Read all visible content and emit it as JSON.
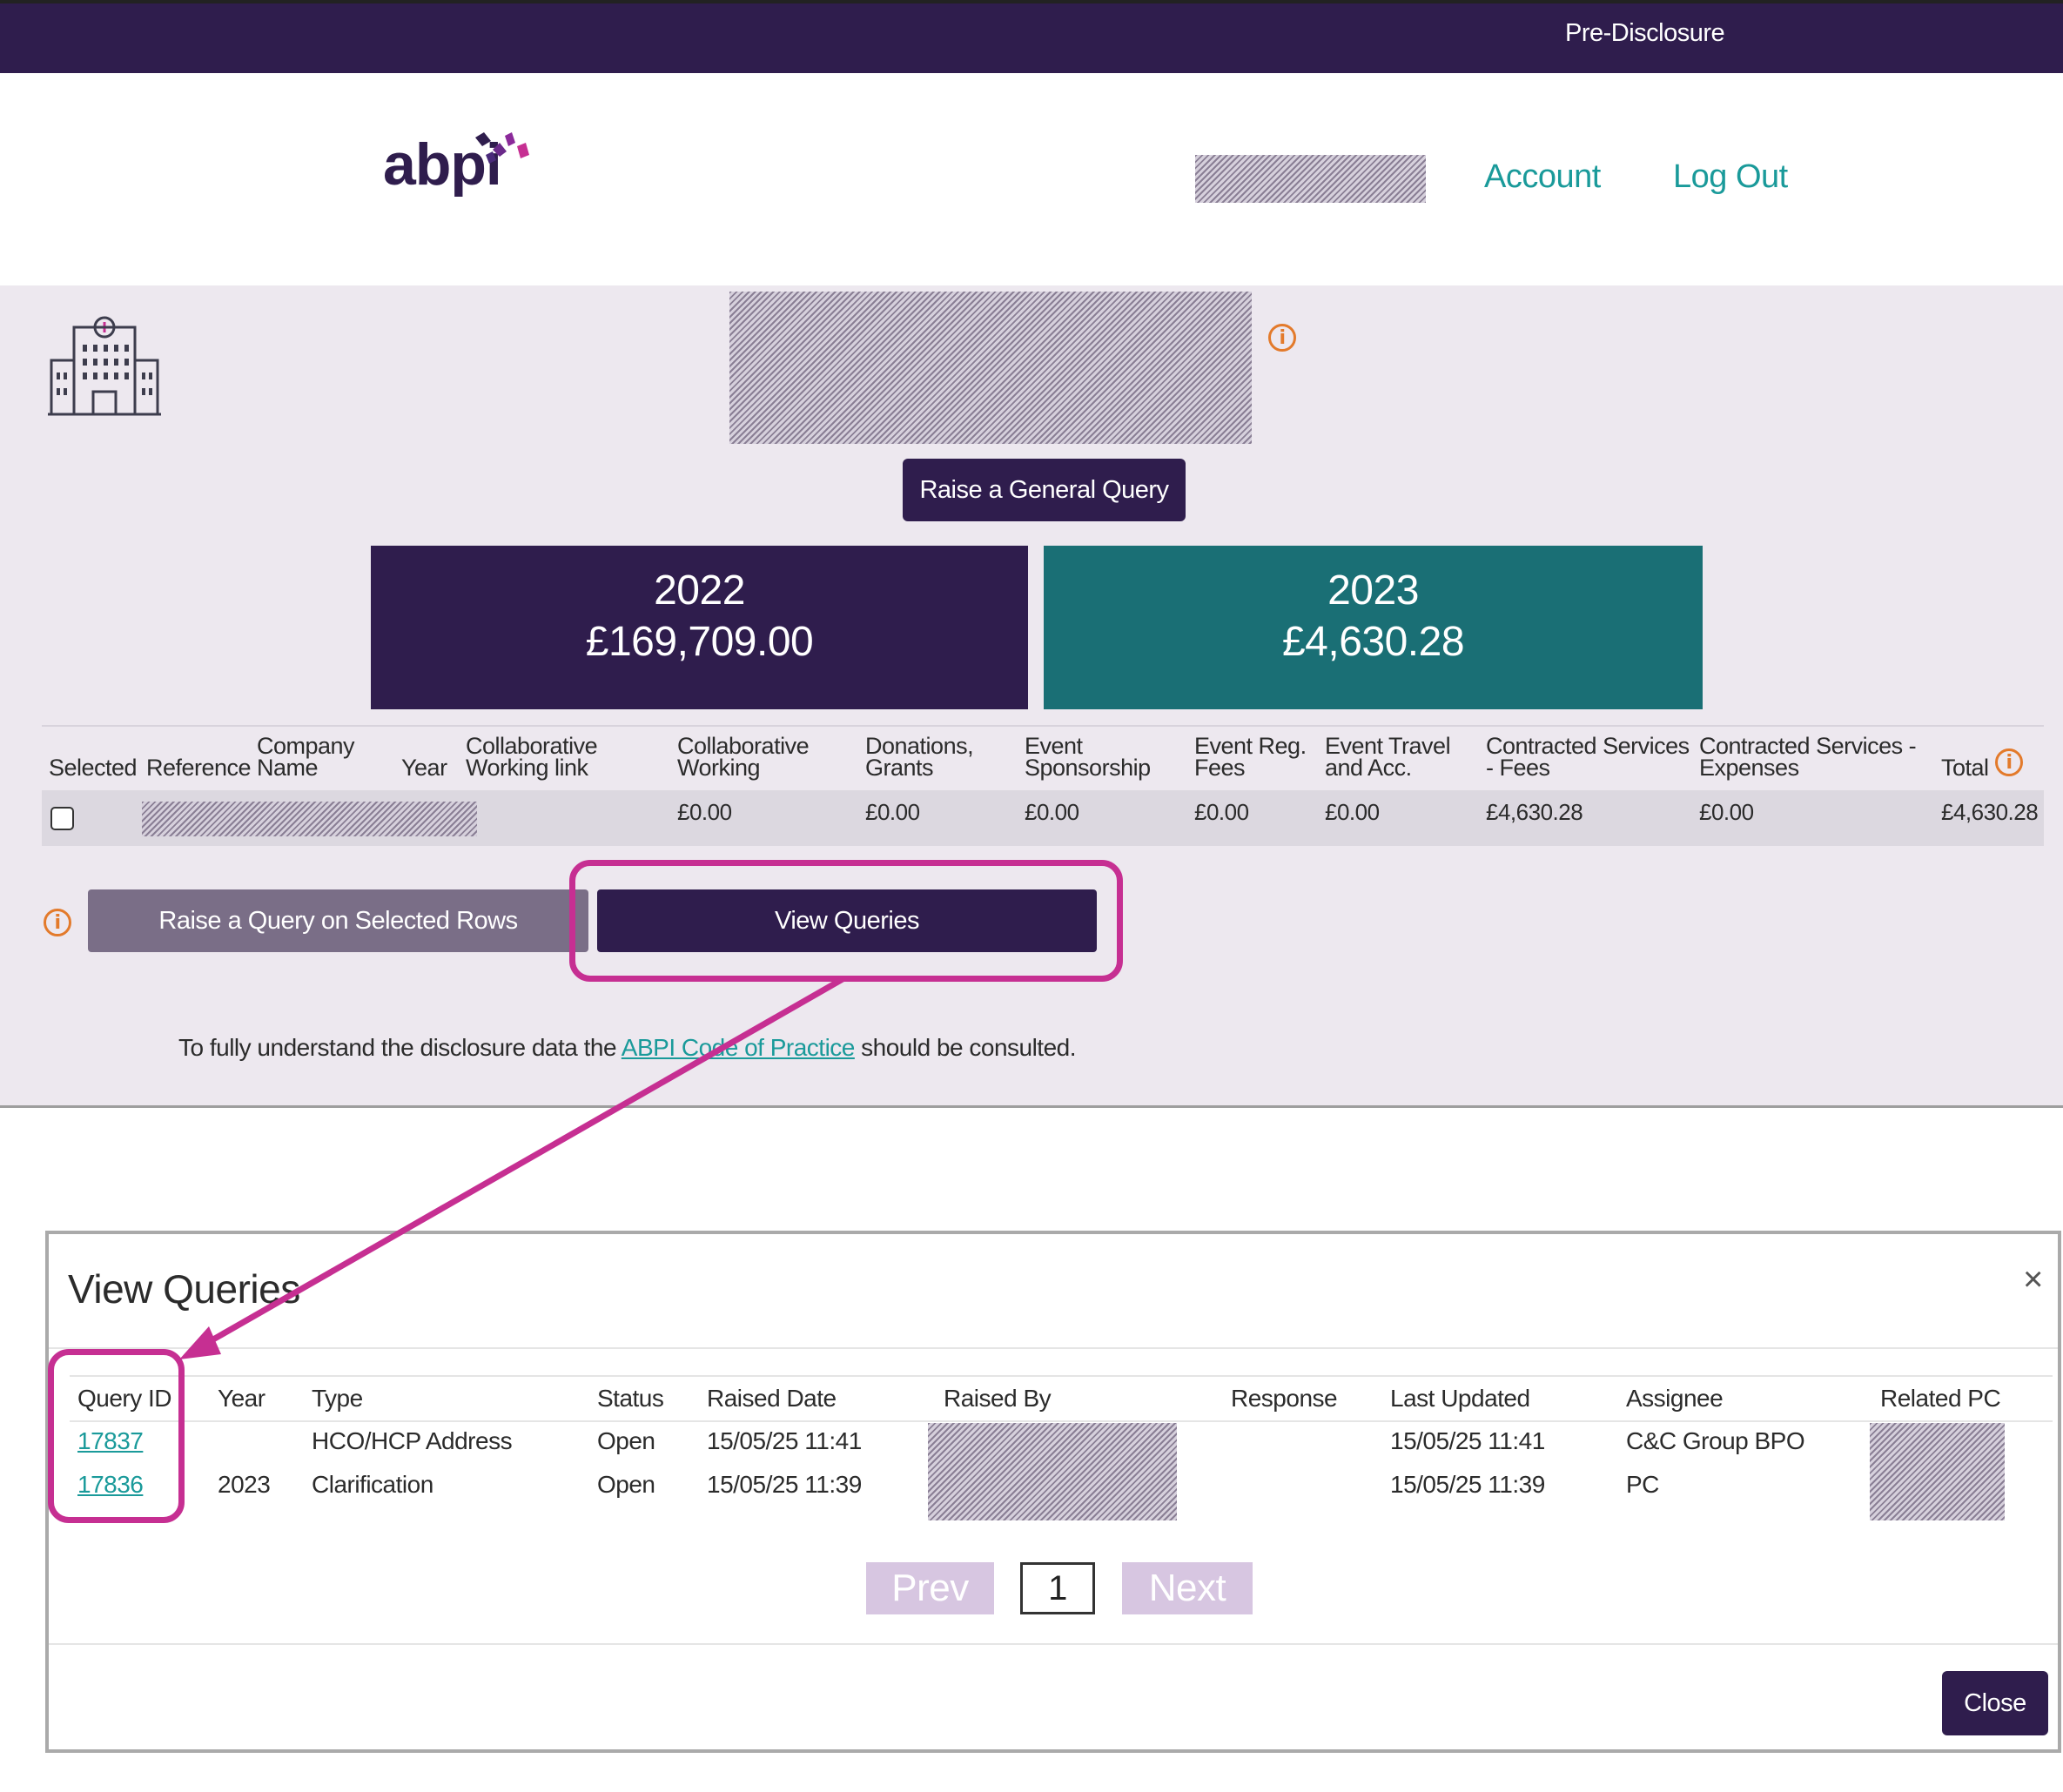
{
  "topbar": {
    "pre_disclosure": "Pre-Disclosure"
  },
  "header": {
    "logo_text": "abpi",
    "nav": {
      "account": "Account",
      "logout": "Log Out"
    }
  },
  "profile": {
    "raise_general_query": "Raise a General Query",
    "totals": [
      {
        "year": "2022",
        "amount": "£169,709.00"
      },
      {
        "year": "2023",
        "amount": "£4,630.28"
      }
    ]
  },
  "table": {
    "headers": {
      "selected": "Selected",
      "reference": "Reference",
      "company_name_1": "Company",
      "company_name_2": "Name",
      "year": "Year",
      "collab_link_1": "Collaborative",
      "collab_link_2": "Working link",
      "collab_1": "Collaborative",
      "collab_2": "Working",
      "donations_1": "Donations,",
      "donations_2": "Grants",
      "event_sp_1": "Event",
      "event_sp_2": "Sponsorship",
      "event_reg_1": "Event Reg.",
      "event_reg_2": "Fees",
      "event_travel_1": "Event Travel",
      "event_travel_2": "and Acc.",
      "cs_fees_1": "Contracted Services",
      "cs_fees_2": "- Fees",
      "cs_exp_1": "Contracted Services -",
      "cs_exp_2": "Expenses",
      "total": "Total"
    },
    "row": {
      "collab": "£0.00",
      "donations": "£0.00",
      "event_sp": "£0.00",
      "event_reg": "£0.00",
      "event_travel": "£0.00",
      "cs_fees": "£4,630.28",
      "cs_exp": "£0.00",
      "total": "£4,630.28"
    }
  },
  "actions": {
    "raise_selected": "Raise a Query on Selected Rows",
    "view_queries": "View Queries"
  },
  "footer_note": {
    "before": "To fully understand the disclosure data the ",
    "link": "ABPI Code of Practice",
    "after": " should be consulted."
  },
  "modal": {
    "title": "View Queries",
    "close_x": "×",
    "headers": {
      "query_id": "Query ID",
      "year": "Year",
      "type": "Type",
      "status": "Status",
      "raised_date": "Raised Date",
      "raised_by": "Raised By",
      "response": "Response",
      "last_updated": "Last Updated",
      "assignee": "Assignee",
      "related_pc": "Related PC"
    },
    "rows": [
      {
        "query_id": "17837",
        "year": "",
        "type": "HCO/HCP Address",
        "status": "Open",
        "raised_date": "15/05/25 11:41",
        "last_updated": "15/05/25 11:41",
        "assignee": "C&C Group BPO"
      },
      {
        "query_id": "17836",
        "year": "2023",
        "type": "Clarification",
        "status": "Open",
        "raised_date": "15/05/25 11:39",
        "last_updated": "15/05/25 11:39",
        "assignee": "PC"
      }
    ],
    "pagination": {
      "prev": "Prev",
      "page": "1",
      "next": "Next"
    },
    "close_button": "Close"
  },
  "colors": {
    "brand_dark": "#2f1d4d",
    "brand_teal": "#1a6f75",
    "link": "#1a9a9a",
    "highlight": "#c62f92",
    "info": "#e37a2b"
  }
}
